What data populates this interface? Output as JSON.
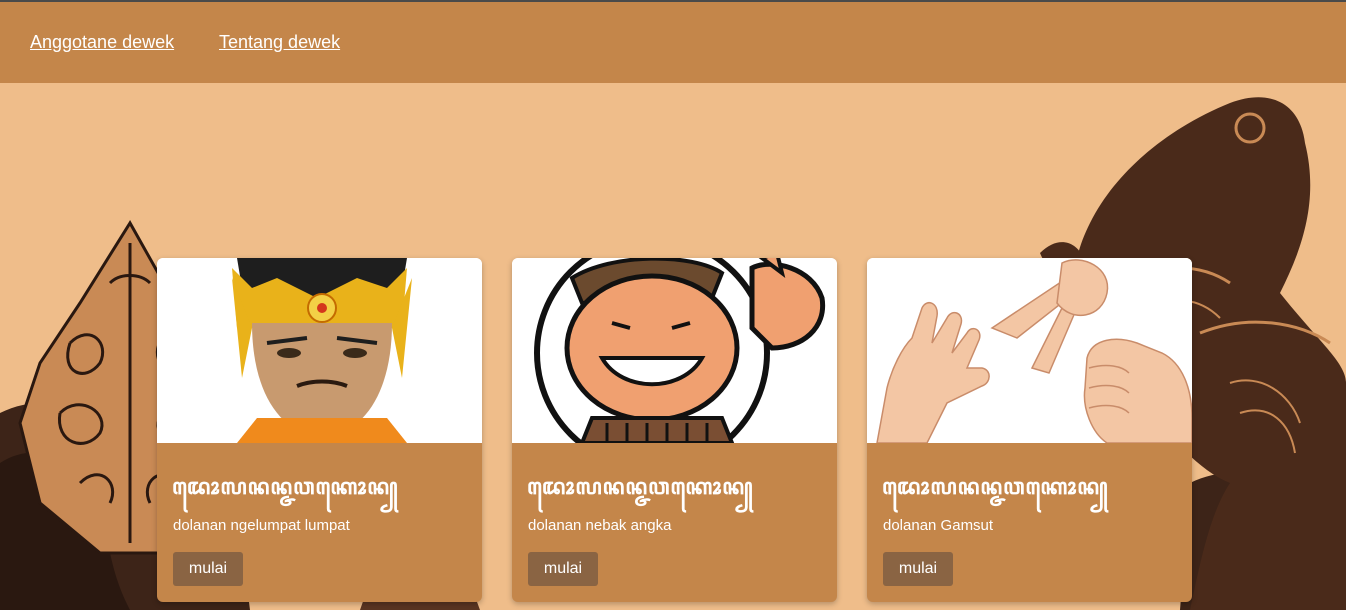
{
  "nav": {
    "links": [
      {
        "label": "Anggotane dewek"
      },
      {
        "label": "Tentang dewek"
      }
    ]
  },
  "cards": [
    {
      "title": "ꦢꦺꦴꦭꦤꦤ꧀ꦗꦮꦏꦺꦴꦤ꧀",
      "description": "dolanan ngelumpat lumpat",
      "button": "mulai",
      "image_icon": "wayang-king-icon"
    },
    {
      "title": "ꦢꦺꦴꦭꦤꦤ꧀ꦗꦮꦏꦺꦴꦤ꧀",
      "description": "dolanan nebak angka",
      "button": "mulai",
      "image_icon": "smiling-man-thumbs-up-icon"
    },
    {
      "title": "ꦢꦺꦴꦭꦤꦤ꧀ꦗꦮꦏꦺꦴꦤ꧀",
      "description": "dolanan Gamsut",
      "button": "mulai",
      "image_icon": "rock-paper-scissors-hands-icon"
    }
  ],
  "colors": {
    "navbar": "#c4864a",
    "background": "#efbd8a",
    "card": "#c4864a",
    "button": "#8a6443",
    "silhouette": "#4a2a1a"
  }
}
